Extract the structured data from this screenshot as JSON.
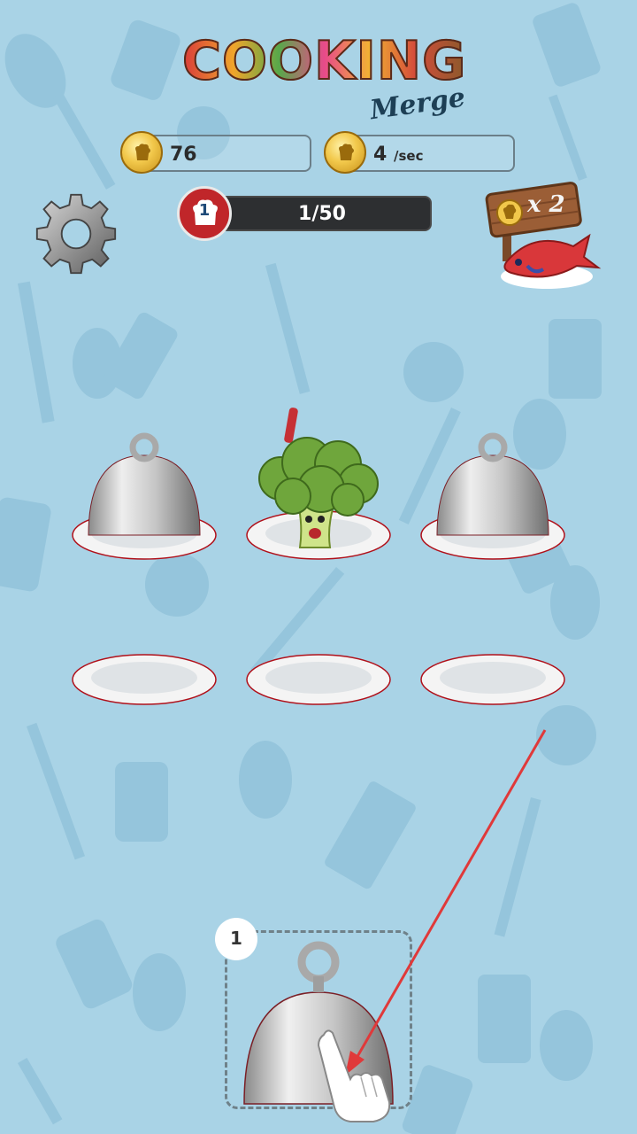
{
  "logo": {
    "word": "COOKING",
    "sub": "Merge"
  },
  "coins": {
    "total": "76",
    "rate": "4",
    "rate_unit": "/sec"
  },
  "level": {
    "badge": "1",
    "progress_text": "1/50"
  },
  "bonus": {
    "label": "x 2"
  },
  "board": {
    "slots": [
      {
        "content": "cloche"
      },
      {
        "content": "broccoli"
      },
      {
        "content": "cloche"
      },
      {
        "content": "empty-plate"
      },
      {
        "content": "empty-plate"
      },
      {
        "content": "empty-plate"
      }
    ]
  },
  "spawner": {
    "count": "1",
    "content": "cloche"
  },
  "icons": {
    "settings": "gear-icon",
    "coin": "chef-coin-icon",
    "level": "chef-hat-icon",
    "bonus_item": "fish-icon",
    "tutorial": "pointing-hand-icon"
  },
  "colors": {
    "background": "#a9d3e6",
    "pattern": "#86b9d2",
    "levelbar": "#2d2f31",
    "level_badge": "#c0262a",
    "coin": "#f2c84b",
    "arrow": "#e0393a"
  }
}
